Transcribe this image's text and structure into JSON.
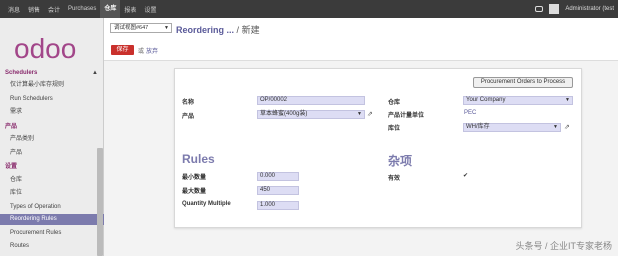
{
  "topbar": {
    "menu": [
      "消息",
      "销售",
      "会计",
      "Purchases",
      "仓库",
      "报表",
      "设置"
    ],
    "active": "仓库",
    "user": "Administrator (test"
  },
  "logo": "odoo",
  "sidebar": {
    "items": [
      {
        "label": "Schedulers",
        "section": true
      },
      {
        "label": "仅计算最小库存规则"
      },
      {
        "label": "Run Schedulers"
      },
      {
        "label": "需求"
      },
      {
        "label": "产品",
        "section": true
      },
      {
        "label": "产品类别"
      },
      {
        "label": "产品"
      },
      {
        "label": "设置",
        "section": true
      },
      {
        "label": "仓库"
      },
      {
        "label": "库位"
      },
      {
        "label": "Types of Operation"
      },
      {
        "label": "Reordering Rules",
        "active": true
      },
      {
        "label": "Procurement Rules"
      },
      {
        "label": "Routes"
      }
    ]
  },
  "header": {
    "view_select": "调试视图#647",
    "breadcrumb_link": "Reordering ...",
    "breadcrumb_sep": "/",
    "breadcrumb_current": "新建",
    "save_label": "保存",
    "or_label": "或",
    "discard_label": "放弃"
  },
  "form": {
    "proc_button": "Procurement Orders to Process",
    "name_label": "名称",
    "name_value": "OP/00002",
    "product_label": "产品",
    "product_value": "草本蜂蜜(400g装)",
    "warehouse_label": "仓库",
    "warehouse_value": "Your Company",
    "uom_label": "产品计量单位",
    "uom_value": "PEC",
    "location_label": "库位",
    "location_value": "WH/库存",
    "rules_title": "Rules",
    "misc_title": "杂项",
    "min_label": "最小数量",
    "min_value": "0.000",
    "max_label": "最大数量",
    "max_value": "450",
    "multiple_label": "Quantity Multiple",
    "multiple_value": "1.000",
    "active_label": "有效",
    "active_checked": "✔"
  },
  "watermark": "头条号 / 企业IT专家老杨",
  "colors": {
    "accent": "#7c7bad",
    "save": "#c9302c",
    "field_bg": "#ddddf4"
  }
}
